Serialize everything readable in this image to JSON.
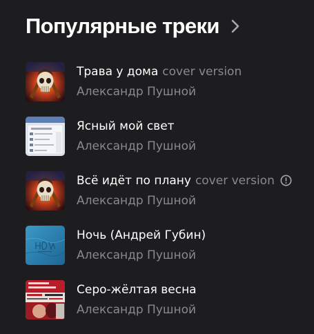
{
  "section": {
    "title": "Популярные треки",
    "chevron_icon": "chevron-right-icon"
  },
  "tracks": [
    {
      "title": "Трава у дома",
      "version": "cover version",
      "artist": "Александр Пушной",
      "cover_icon": "skull-guitars-cover",
      "explicit": false
    },
    {
      "title": "Ясный мой свет",
      "version": "",
      "artist": "Александр Пушной",
      "cover_icon": "screenshot-window-cover",
      "explicit": false
    },
    {
      "title": "Всё идёт по плану",
      "version": "cover version",
      "artist": "Александр Пушной",
      "cover_icon": "skull-guitars-cover",
      "explicit": true
    },
    {
      "title": "Ночь (Андрей Губин)",
      "version": "",
      "artist": "Александр Пушной",
      "cover_icon": "blue-texture-cover",
      "explicit": false
    },
    {
      "title": "Серо-жёлтая весна",
      "version": "",
      "artist": "Александр Пушной",
      "cover_icon": "red-collage-cover",
      "explicit": false
    }
  ],
  "colors": {
    "background": "#1d1d20",
    "primary_text": "#ffffff",
    "secondary_text": "#8a8a8e"
  }
}
